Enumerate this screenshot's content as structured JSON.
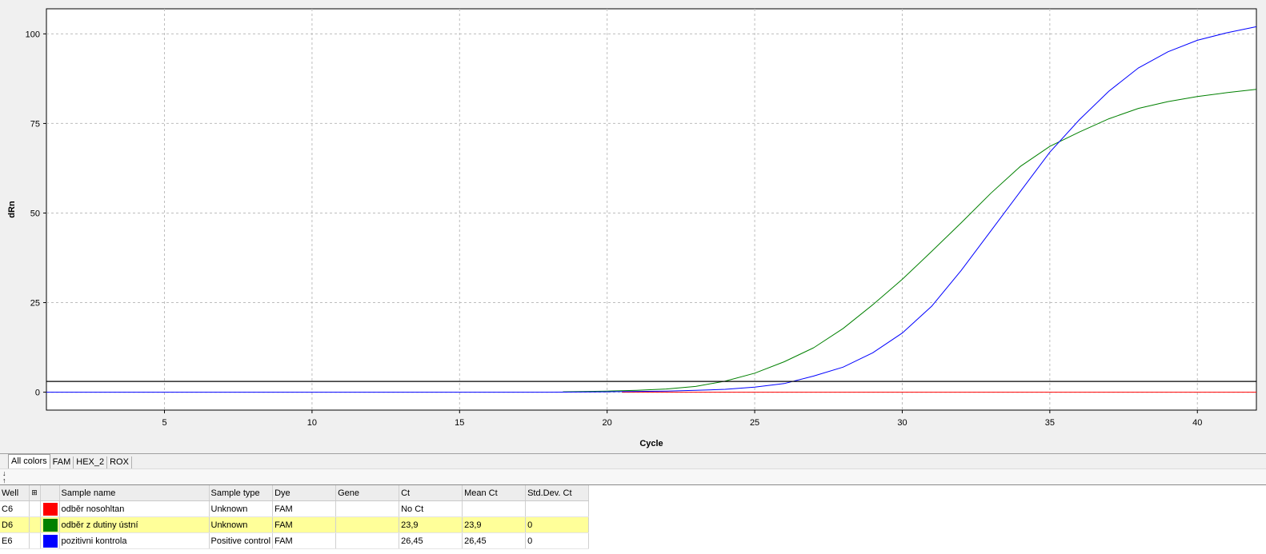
{
  "chart_data": {
    "type": "line",
    "title": "",
    "xlabel": "Cycle",
    "ylabel": "dRn",
    "xlim": [
      1,
      42
    ],
    "ylim": [
      -5,
      107
    ],
    "x_ticks": [
      5,
      10,
      15,
      20,
      25,
      30,
      35,
      40
    ],
    "y_ticks": [
      0,
      25,
      50,
      75,
      100
    ],
    "grid": true,
    "threshold": 3,
    "series": [
      {
        "color": "#ff0000",
        "x": [
          20.5,
          42
        ],
        "y": [
          0,
          0
        ]
      },
      {
        "color": "#008000",
        "x": [
          18.5,
          20,
          21,
          22,
          23,
          24,
          25,
          26,
          27,
          28,
          29,
          30,
          31,
          32,
          33,
          34,
          35,
          36,
          37,
          38,
          39,
          40,
          41,
          42
        ],
        "y": [
          0.1,
          0.3,
          0.5,
          0.9,
          1.6,
          3.1,
          5.3,
          8.5,
          12.4,
          17.8,
          24.4,
          31.5,
          39.3,
          47.3,
          55.5,
          63.0,
          68.6,
          72.6,
          76.3,
          79.2,
          81.1,
          82.5,
          83.6,
          84.5
        ]
      },
      {
        "color": "#0000ff",
        "x": [
          1,
          18,
          20,
          22,
          23,
          24,
          25,
          26,
          27,
          28,
          29,
          30,
          31,
          32,
          33,
          34,
          35,
          36,
          37,
          38,
          39,
          40,
          41,
          42
        ],
        "y": [
          0,
          0,
          0.1,
          0.3,
          0.5,
          0.8,
          1.4,
          2.4,
          4.5,
          7.0,
          11.0,
          16.5,
          24.0,
          34.0,
          45.0,
          56.0,
          67.0,
          76.0,
          84.0,
          90.5,
          95.0,
          98.2,
          100.3,
          102.0
        ]
      }
    ]
  },
  "tabs": [
    "All colors",
    "FAM",
    "HEX_2",
    "ROX"
  ],
  "table": {
    "columns": [
      "Well",
      "",
      "Sample name",
      "Sample type",
      "Dye",
      "Gene",
      "Ct",
      "Mean Ct",
      "Std.Dev. Ct"
    ],
    "rows": [
      {
        "well": "C6",
        "color": "#ff0000",
        "sample_name": "odběr nosohltan",
        "sample_type": "Unknown",
        "dye": "FAM",
        "gene": "",
        "ct": "No Ct",
        "mean_ct": "",
        "std_dev_ct": ""
      },
      {
        "well": "D6",
        "color": "#008000",
        "sample_name": "odběr z dutiny ústní",
        "sample_type": "Unknown",
        "dye": "FAM",
        "gene": "",
        "ct": "23,9",
        "mean_ct": "23,9",
        "std_dev_ct": "0"
      },
      {
        "well": "E6",
        "color": "#0000ff",
        "sample_name": "pozitivni kontrola",
        "sample_type": "Positive control",
        "dye": "FAM",
        "gene": "",
        "ct": "26,45",
        "mean_ct": "26,45",
        "std_dev_ct": "0"
      }
    ]
  },
  "colors": {
    "threshold": "#000000",
    "grid": "#bdbdbd",
    "highlight_row": "#ffff99"
  }
}
